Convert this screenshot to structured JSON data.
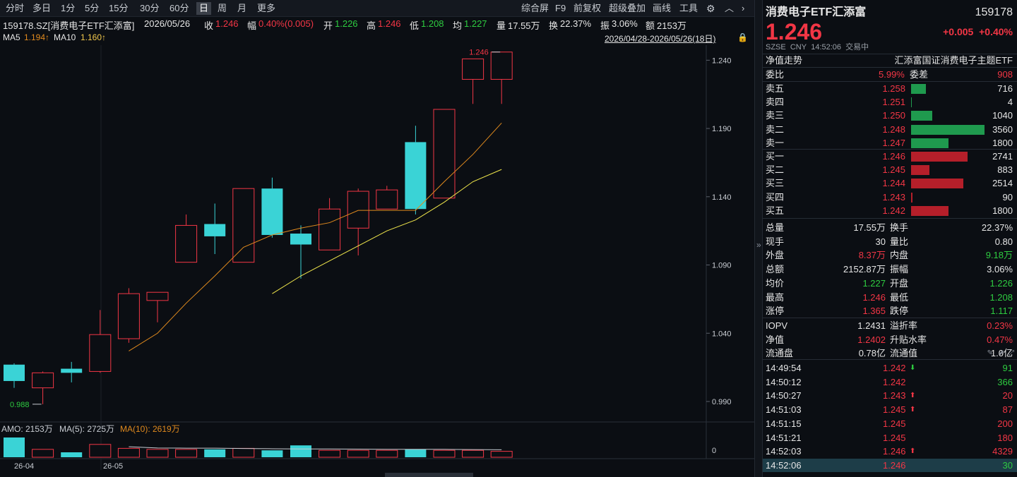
{
  "toolbar": {
    "periods": [
      "分时",
      "多日",
      "1分",
      "5分",
      "15分",
      "30分",
      "60分",
      "日",
      "周",
      "月",
      "更多"
    ],
    "active_period": "日",
    "right_tools": [
      "综合屏",
      "F9",
      "前复权",
      "超级叠加",
      "画线",
      "工具"
    ]
  },
  "info": {
    "symbol": "159178.SZ[消费电子ETF汇添富]",
    "date": "2026/05/26",
    "close_label": "收",
    "close": "1.246",
    "change_label": "幅",
    "change": "0.40%(0.005)",
    "open_label": "开",
    "open": "1.226",
    "high_label": "高",
    "high": "1.246",
    "low_label": "低",
    "low": "1.208",
    "avg_label": "均",
    "avg": "1.227",
    "vol_label": "量",
    "vol": "17.55万",
    "turnover_label": "换",
    "turnover": "22.37%",
    "amp_label": "振",
    "amp": "3.06%",
    "amount_label": "额",
    "amount": "2153万",
    "range": "2026/04/28-2026/05/26(18日)"
  },
  "ma": {
    "ma5_label": "MA5",
    "ma5": "1.194↑",
    "ma10_label": "MA10",
    "ma10": "1.160↑"
  },
  "volume_panel": {
    "amo_label": "AMO: 2153万",
    "ma5_label": "MA(5): 2725万",
    "ma10_label": "MA(10): 2619万",
    "zero_label": "0"
  },
  "colors": {
    "up": "#f23645",
    "down": "#3ad3d6",
    "ma5": "#e08a1e",
    "ma10": "#f2e84c",
    "bg": "#0b0e13"
  },
  "chart_data": {
    "type": "candlestick",
    "y_ticks": [
      "1.240",
      "1.190",
      "1.140",
      "1.090",
      "1.040",
      "0.990"
    ],
    "x_ticks": [
      "26-04",
      "26-05"
    ],
    "ylim": [
      0.975,
      1.25
    ],
    "max_marker": "1.246",
    "min_marker": "0.988",
    "candles": [
      {
        "o": 1.017,
        "h": 1.018,
        "l": 1.0,
        "c": 1.005
      },
      {
        "o": 1.0,
        "h": 1.012,
        "l": 0.988,
        "c": 1.011
      },
      {
        "o": 1.014,
        "h": 1.019,
        "l": 1.004,
        "c": 1.011
      },
      {
        "o": 1.012,
        "h": 1.057,
        "l": 1.011,
        "c": 1.039
      },
      {
        "o": 1.036,
        "h": 1.073,
        "l": 1.033,
        "c": 1.069
      },
      {
        "o": 1.064,
        "h": 1.07,
        "l": 1.048,
        "c": 1.07
      },
      {
        "o": 1.092,
        "h": 1.127,
        "l": 1.092,
        "c": 1.119
      },
      {
        "o": 1.12,
        "h": 1.135,
        "l": 1.098,
        "c": 1.111
      },
      {
        "o": 1.092,
        "h": 1.146,
        "l": 1.092,
        "c": 1.146
      },
      {
        "o": 1.146,
        "h": 1.154,
        "l": 1.11,
        "c": 1.112
      },
      {
        "o": 1.113,
        "h": 1.119,
        "l": 1.08,
        "c": 1.105
      },
      {
        "o": 1.101,
        "h": 1.139,
        "l": 1.101,
        "c": 1.131
      },
      {
        "o": 1.117,
        "h": 1.146,
        "l": 1.097,
        "c": 1.144
      },
      {
        "o": 1.131,
        "h": 1.148,
        "l": 1.131,
        "c": 1.145
      },
      {
        "o": 1.18,
        "h": 1.192,
        "l": 1.127,
        "c": 1.131
      },
      {
        "o": 1.139,
        "h": 1.204,
        "l": 1.139,
        "c": 1.204
      },
      {
        "o": 1.226,
        "h": 1.241,
        "l": 1.208,
        "c": 1.241
      },
      {
        "o": 1.226,
        "h": 1.246,
        "l": 1.208,
        "c": 1.246
      }
    ],
    "ma5": [
      null,
      null,
      null,
      null,
      1.027,
      1.04,
      1.062,
      1.082,
      1.103,
      1.112,
      1.117,
      1.121,
      1.13,
      1.13,
      1.13,
      1.151,
      1.171,
      1.194
    ],
    "ma10": [
      null,
      null,
      null,
      null,
      null,
      null,
      null,
      null,
      null,
      1.069,
      1.082,
      1.093,
      1.104,
      1.115,
      1.123,
      1.136,
      1.151,
      1.16
    ],
    "volumes": [
      1.0,
      0.4,
      0.25,
      0.65,
      0.45,
      0.4,
      0.4,
      0.4,
      0.45,
      0.35,
      0.6,
      0.35,
      0.35,
      0.35,
      0.4,
      0.35,
      0.35,
      0.3
    ],
    "vol_ma": [
      null,
      null,
      null,
      null,
      0.53,
      0.47,
      0.46,
      0.46,
      0.44,
      0.43,
      0.42,
      0.42,
      0.41,
      0.4,
      0.4,
      0.4,
      0.39,
      0.38
    ]
  },
  "quote": {
    "name": "消费电子ETF汇添富",
    "code": "159178",
    "price": "1.246",
    "change": "+0.005",
    "change_pct": "+0.40%",
    "exchange": "SZSE",
    "currency": "CNY",
    "time": "14:52:06",
    "status": "交易中",
    "nav_trend_label": "净值走势",
    "index_name": "汇添富国证消费电子主题ETF"
  },
  "orderbook": {
    "wb_label": "委比",
    "wb": "5.99%",
    "wc_label": "委差",
    "wc": "908",
    "asks": [
      {
        "label": "卖五",
        "price": "1.258",
        "vol": "716",
        "ratio": 0.2
      },
      {
        "label": "卖四",
        "price": "1.251",
        "vol": "4",
        "ratio": 0.01
      },
      {
        "label": "卖三",
        "price": "1.250",
        "vol": "1040",
        "ratio": 0.29
      },
      {
        "label": "卖二",
        "price": "1.248",
        "vol": "3560",
        "ratio": 1.0
      },
      {
        "label": "卖一",
        "price": "1.247",
        "vol": "1800",
        "ratio": 0.51
      }
    ],
    "bids": [
      {
        "label": "买一",
        "price": "1.246",
        "vol": "2741",
        "ratio": 0.77
      },
      {
        "label": "买二",
        "price": "1.245",
        "vol": "883",
        "ratio": 0.25
      },
      {
        "label": "买三",
        "price": "1.244",
        "vol": "2514",
        "ratio": 0.71
      },
      {
        "label": "买四",
        "price": "1.243",
        "vol": "90",
        "ratio": 0.02
      },
      {
        "label": "买五",
        "price": "1.242",
        "vol": "1800",
        "ratio": 0.51
      }
    ]
  },
  "stats": [
    {
      "l1": "总量",
      "v1": "17.55万",
      "c1": "white",
      "l2": "换手",
      "v2": "22.37%",
      "c2": "white"
    },
    {
      "l1": "现手",
      "v1": "30",
      "c1": "white",
      "l2": "量比",
      "v2": "0.80",
      "c2": "white"
    },
    {
      "l1": "外盘",
      "v1": "8.37万",
      "c1": "red",
      "l2": "内盘",
      "v2": "9.18万",
      "c2": "green"
    },
    {
      "l1": "总额",
      "v1": "2152.87万",
      "c1": "white",
      "l2": "振幅",
      "v2": "3.06%",
      "c2": "white"
    },
    {
      "l1": "均价",
      "v1": "1.227",
      "c1": "green",
      "l2": "开盘",
      "v2": "1.226",
      "c2": "green"
    },
    {
      "l1": "最高",
      "v1": "1.246",
      "c1": "red",
      "l2": "最低",
      "v2": "1.208",
      "c2": "green"
    },
    {
      "l1": "涨停",
      "v1": "1.365",
      "c1": "red",
      "l2": "跌停",
      "v2": "1.117",
      "c2": "green"
    }
  ],
  "stats2": [
    {
      "l1": "IOPV",
      "v1": "1.2431",
      "c1": "white",
      "l2": "溢折率",
      "v2": "0.23%",
      "c2": "red"
    },
    {
      "l1": "净值",
      "v1": "1.2402",
      "c1": "red",
      "l2": "升贴水率",
      "v2": "0.47%",
      "c2": "red"
    },
    {
      "l1": "流通盘",
      "v1": "0.78亿",
      "c1": "white",
      "l2": "流通值",
      "v2": "1.0亿",
      "c2": "white"
    }
  ],
  "ticks": [
    {
      "time": "14:49:54",
      "price": "1.242",
      "dir": "down",
      "vol": "91",
      "vc": "green"
    },
    {
      "time": "14:50:12",
      "price": "1.242",
      "dir": "",
      "vol": "366",
      "vc": "green"
    },
    {
      "time": "14:50:27",
      "price": "1.243",
      "dir": "up",
      "vol": "20",
      "vc": "red"
    },
    {
      "time": "14:51:03",
      "price": "1.245",
      "dir": "up",
      "vol": "87",
      "vc": "red"
    },
    {
      "time": "14:51:15",
      "price": "1.245",
      "dir": "",
      "vol": "200",
      "vc": "red"
    },
    {
      "time": "14:51:21",
      "price": "1.245",
      "dir": "",
      "vol": "180",
      "vc": "red"
    },
    {
      "time": "14:52:03",
      "price": "1.246",
      "dir": "up",
      "vol": "4329",
      "vc": "red"
    },
    {
      "time": "14:52:06",
      "price": "1.246",
      "dir": "",
      "vol": "30",
      "vc": "green"
    }
  ]
}
